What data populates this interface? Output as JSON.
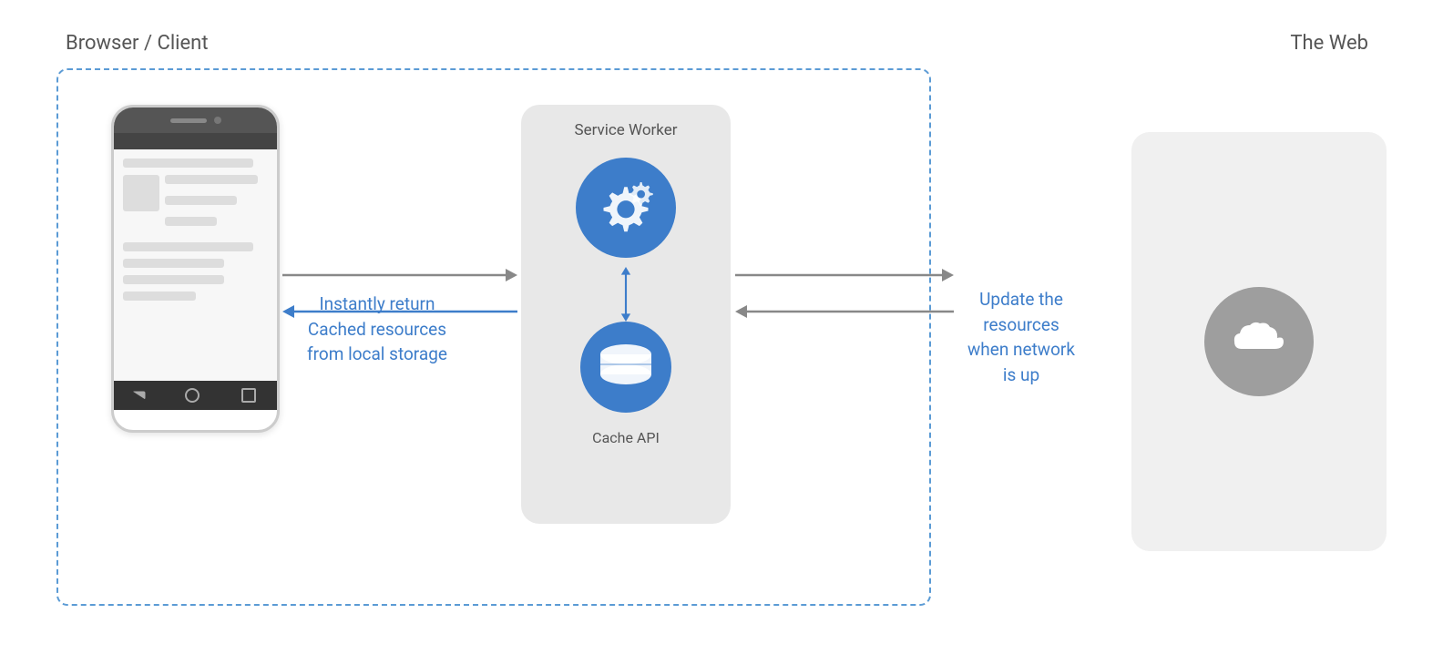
{
  "labels": {
    "browser_client": "Browser / Client",
    "the_web": "The Web",
    "service_worker": "Service Worker",
    "cache_api": "Cache API",
    "instantly_return": "Instantly return",
    "cached_resources": "Cached resources",
    "from_local_storage": "from local storage",
    "update_the": "Update the",
    "resources": "resources",
    "when_network": "when network",
    "is_up": "is up"
  },
  "colors": {
    "blue_accent": "#3d7dca",
    "dashed_border": "#5b9bd5",
    "panel_bg": "#e8e8e8",
    "web_bg": "#f0f0f0",
    "text_gray": "#555"
  }
}
